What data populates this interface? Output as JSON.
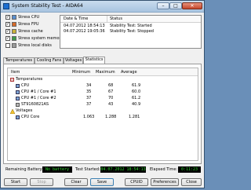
{
  "window": {
    "title": "System Stability Test - AIDA64",
    "minimize": "–",
    "maximize": "□",
    "close": "✕"
  },
  "stress_options": [
    {
      "label": "Stress CPU",
      "checked": true
    },
    {
      "label": "Stress FPU",
      "checked": true
    },
    {
      "label": "Stress cache",
      "checked": true
    },
    {
      "label": "Stress system memory",
      "checked": true
    },
    {
      "label": "Stress local disks",
      "checked": false
    }
  ],
  "log": {
    "headers": {
      "datetime": "Date & Time",
      "status": "Status"
    },
    "rows": [
      {
        "datetime": "04.07.2012 18:54:13",
        "status": "Stability Test: Started"
      },
      {
        "datetime": "04.07.2012 19:05:36",
        "status": "Stability Test: Stopped"
      }
    ]
  },
  "tabs": [
    "Temperatures",
    "Cooling Fans",
    "Voltages",
    "Statistics"
  ],
  "active_tab": "Statistics",
  "stats": {
    "headers": {
      "item": "Item",
      "minimum": "Minimum",
      "maximum": "Maximum",
      "average": "Average"
    },
    "groups": [
      {
        "label": "Temperatures",
        "rows": [
          {
            "item": "CPU",
            "minimum": "34",
            "maximum": "68",
            "average": "61.9"
          },
          {
            "item": "CPU #1 / Core #1",
            "minimum": "35",
            "maximum": "67",
            "average": "60.0"
          },
          {
            "item": "CPU #1 / Core #2",
            "minimum": "37",
            "maximum": "70",
            "average": "61.2"
          },
          {
            "item": "ST9160821AS",
            "minimum": "37",
            "maximum": "43",
            "average": "40.9"
          }
        ]
      },
      {
        "label": "Voltages",
        "rows": [
          {
            "item": "CPU Core",
            "minimum": "1.063",
            "maximum": "1.288",
            "average": "1.281"
          }
        ]
      }
    ]
  },
  "status_bar": {
    "battery_label": "Remaining Battery:",
    "battery_value": "No battery",
    "started_label": "Test Started:",
    "started_value": "04.07.2012 18:54:13",
    "elapsed_label": "Elapsed Time:",
    "elapsed_value": "0:11:23"
  },
  "buttons": {
    "start": "Start",
    "stop": "Stop",
    "clear": "Clear",
    "save": "Save",
    "cpuid": "CPUID",
    "preferences": "Preferences",
    "close": "Close"
  },
  "colors": {
    "status_text": "#2fd12f",
    "status_bg": "#000000",
    "titlebar": "#b8d0e8"
  },
  "icons": {
    "temperatures": "thermometer-icon",
    "cpu": "cpu-chip-icon",
    "disk": "hard-disk-icon",
    "voltages": "warning-triangle-icon"
  }
}
